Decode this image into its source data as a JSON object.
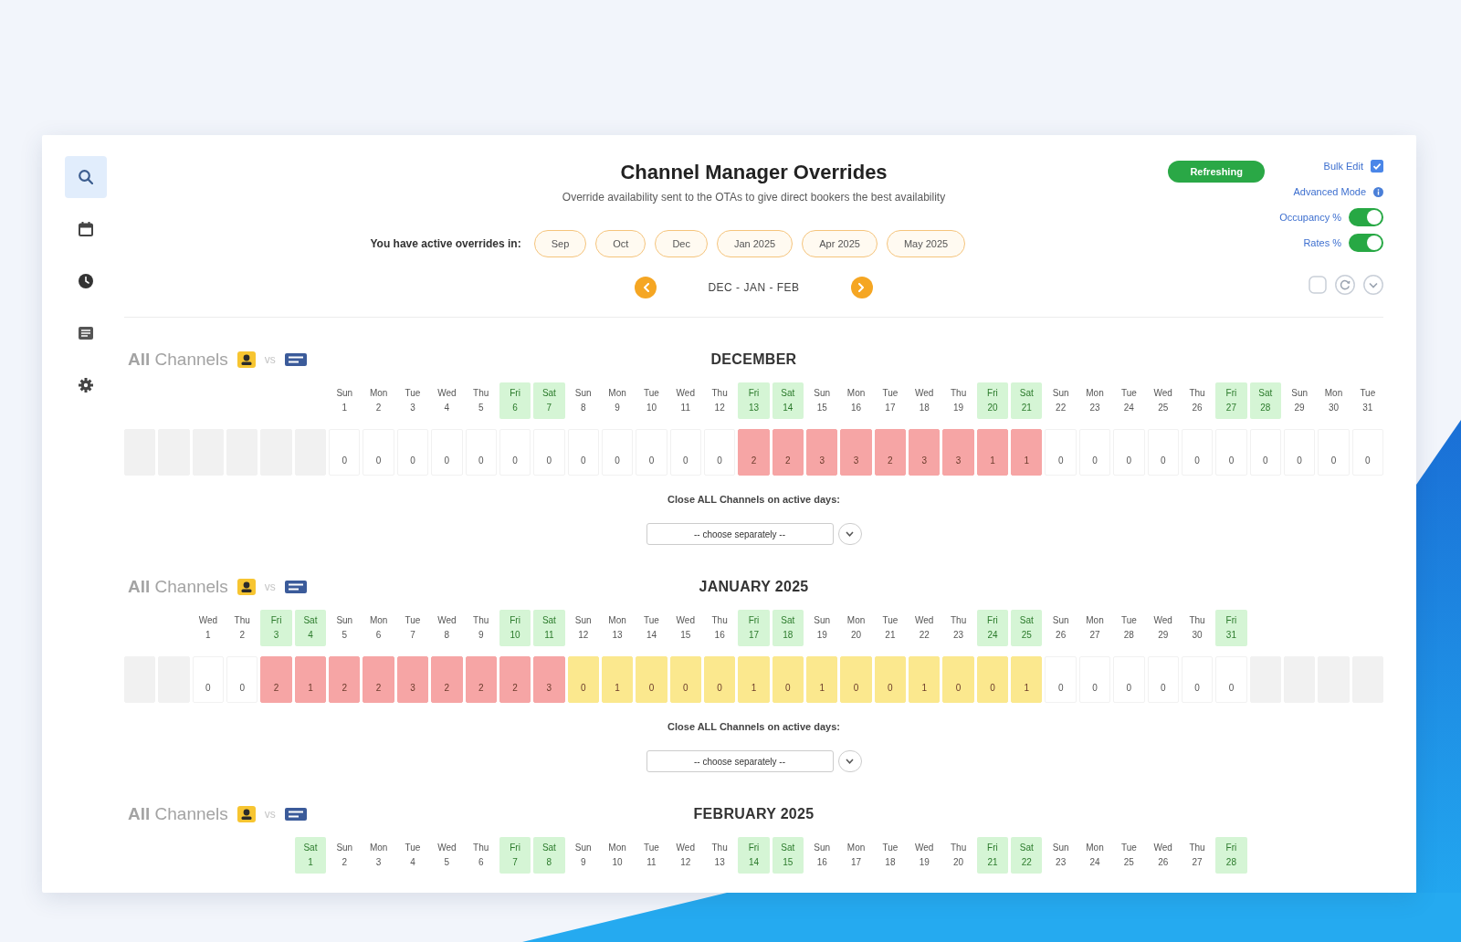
{
  "sidebar": {
    "items": [
      {
        "kind": "search",
        "selected": true
      },
      {
        "kind": "calendar",
        "selected": false
      },
      {
        "kind": "clock",
        "selected": false
      },
      {
        "kind": "list",
        "selected": false
      },
      {
        "kind": "settings",
        "selected": false
      }
    ]
  },
  "header": {
    "title": "Channel Manager Overrides",
    "subtitle": "Override availability sent to the OTAs to give direct bookers the best availability",
    "active_overrides": {
      "label": "You have active overrides in:",
      "months": [
        "Sep",
        "Oct",
        "Dec",
        "Jan 2025",
        "Apr 2025",
        "May 2025"
      ]
    },
    "navigation": {
      "range": "DEC - JAN - FEB"
    }
  },
  "status_button": {
    "label": "Refreshing"
  },
  "options": [
    {
      "kind": "checkbox",
      "label": "Bulk Edit",
      "checked": true
    },
    {
      "kind": "info",
      "label": "Advanced Mode"
    },
    {
      "kind": "toggle",
      "label": "Occupancy %",
      "on": true
    },
    {
      "kind": "toggle",
      "label": "Rates %",
      "on": true
    }
  ],
  "months": [
    {
      "channels_label": "**All** Channels",
      "versus": "vs",
      "title": "DECEMBER",
      "columns": [
        {
          "kind": "blank"
        },
        {
          "kind": "blank"
        },
        {
          "kind": "blank"
        },
        {
          "kind": "blank"
        },
        {
          "kind": "blank"
        },
        {
          "kind": "blank"
        },
        {
          "kind": "day",
          "weekday": "Sun",
          "day": "1",
          "weekend": false,
          "value": "0"
        },
        {
          "kind": "day",
          "weekday": "Mon",
          "day": "2",
          "weekend": false,
          "value": "0"
        },
        {
          "kind": "day",
          "weekday": "Tue",
          "day": "3",
          "weekend": false,
          "value": "0"
        },
        {
          "kind": "day",
          "weekday": "Wed",
          "day": "4",
          "weekend": false,
          "value": "0"
        },
        {
          "kind": "day",
          "weekday": "Thu",
          "day": "5",
          "weekend": false,
          "value": "0"
        },
        {
          "kind": "day",
          "weekday": "Fri",
          "day": "6",
          "weekend": true,
          "value": "0"
        },
        {
          "kind": "day",
          "weekday": "Sat",
          "day": "7",
          "weekend": true,
          "value": "0"
        },
        {
          "kind": "day",
          "weekday": "Sun",
          "day": "8",
          "weekend": false,
          "value": "0"
        },
        {
          "kind": "day",
          "weekday": "Mon",
          "day": "9",
          "weekend": false,
          "value": "0"
        },
        {
          "kind": "day",
          "weekday": "Tue",
          "day": "10",
          "weekend": false,
          "value": "0"
        },
        {
          "kind": "day",
          "weekday": "Wed",
          "day": "11",
          "weekend": false,
          "value": "0"
        },
        {
          "kind": "day",
          "weekday": "Thu",
          "day": "12",
          "weekend": false,
          "value": "0"
        },
        {
          "kind": "day",
          "weekday": "Fri",
          "day": "13",
          "weekend": true,
          "value": "2",
          "color": "#f6a5a5"
        },
        {
          "kind": "day",
          "weekday": "Sat",
          "day": "14",
          "weekend": true,
          "value": "2",
          "color": "#f6a5a5"
        },
        {
          "kind": "day",
          "weekday": "Sun",
          "day": "15",
          "weekend": false,
          "value": "3",
          "color": "#f6a5a5"
        },
        {
          "kind": "day",
          "weekday": "Mon",
          "day": "16",
          "weekend": false,
          "value": "3",
          "color": "#f6a5a5"
        },
        {
          "kind": "day",
          "weekday": "Tue",
          "day": "17",
          "weekend": false,
          "value": "2",
          "color": "#f6a5a5"
        },
        {
          "kind": "day",
          "weekday": "Wed",
          "day": "18",
          "weekend": false,
          "value": "3",
          "color": "#f6a5a5"
        },
        {
          "kind": "day",
          "weekday": "Thu",
          "day": "19",
          "weekend": false,
          "value": "3",
          "color": "#f6a5a5"
        },
        {
          "kind": "day",
          "weekday": "Fri",
          "day": "20",
          "weekend": true,
          "value": "1",
          "color": "#f6a5a5"
        },
        {
          "kind": "day",
          "weekday": "Sat",
          "day": "21",
          "weekend": true,
          "value": "1",
          "color": "#f6a5a5"
        },
        {
          "kind": "day",
          "weekday": "Sun",
          "day": "22",
          "weekend": false,
          "value": "0"
        },
        {
          "kind": "day",
          "weekday": "Mon",
          "day": "23",
          "weekend": false,
          "value": "0"
        },
        {
          "kind": "day",
          "weekday": "Tue",
          "day": "24",
          "weekend": false,
          "value": "0"
        },
        {
          "kind": "day",
          "weekday": "Wed",
          "day": "25",
          "weekend": false,
          "value": "0"
        },
        {
          "kind": "day",
          "weekday": "Thu",
          "day": "26",
          "weekend": false,
          "value": "0"
        },
        {
          "kind": "day",
          "weekday": "Fri",
          "day": "27",
          "weekend": true,
          "value": "0"
        },
        {
          "kind": "day",
          "weekday": "Sat",
          "day": "28",
          "weekend": true,
          "value": "0"
        },
        {
          "kind": "day",
          "weekday": "Sun",
          "day": "29",
          "weekend": false,
          "value": "0"
        },
        {
          "kind": "day",
          "weekday": "Mon",
          "day": "30",
          "weekend": false,
          "value": "0"
        },
        {
          "kind": "day",
          "weekday": "Tue",
          "day": "31",
          "weekend": false,
          "value": "0"
        }
      ],
      "close_all": {
        "label": "Close ALL Channels on active days:",
        "value": "-- choose separately --"
      }
    },
    {
      "channels_label": "**All** Channels",
      "versus": "vs",
      "title": "JANUARY 2025",
      "columns": [
        {
          "kind": "blank"
        },
        {
          "kind": "blank"
        },
        {
          "kind": "day",
          "weekday": "Wed",
          "day": "1",
          "weekend": false,
          "value": "0"
        },
        {
          "kind": "day",
          "weekday": "Thu",
          "day": "2",
          "weekend": false,
          "value": "0"
        },
        {
          "kind": "day",
          "weekday": "Fri",
          "day": "3",
          "weekend": true,
          "value": "2",
          "color": "#f6a5a5"
        },
        {
          "kind": "day",
          "weekday": "Sat",
          "day": "4",
          "weekend": true,
          "value": "1",
          "color": "#f6a5a5"
        },
        {
          "kind": "day",
          "weekday": "Sun",
          "day": "5",
          "weekend": false,
          "value": "2",
          "color": "#f6a5a5"
        },
        {
          "kind": "day",
          "weekday": "Mon",
          "day": "6",
          "weekend": false,
          "value": "2",
          "color": "#f6a5a5"
        },
        {
          "kind": "day",
          "weekday": "Tue",
          "day": "7",
          "weekend": false,
          "value": "3",
          "color": "#f6a5a5"
        },
        {
          "kind": "day",
          "weekday": "Wed",
          "day": "8",
          "weekend": false,
          "value": "2",
          "color": "#f6a5a5"
        },
        {
          "kind": "day",
          "weekday": "Thu",
          "day": "9",
          "weekend": false,
          "value": "2",
          "color": "#f6a5a5"
        },
        {
          "kind": "day",
          "weekday": "Fri",
          "day": "10",
          "weekend": true,
          "value": "2",
          "color": "#f6a5a5"
        },
        {
          "kind": "day",
          "weekday": "Sat",
          "day": "11",
          "weekend": true,
          "value": "3",
          "color": "#f6a5a5"
        },
        {
          "kind": "day",
          "weekday": "Sun",
          "day": "12",
          "weekend": false,
          "value": "0",
          "color": "#fbe88e"
        },
        {
          "kind": "day",
          "weekday": "Mon",
          "day": "13",
          "weekend": false,
          "value": "1",
          "color": "#fbe88e"
        },
        {
          "kind": "day",
          "weekday": "Tue",
          "day": "14",
          "weekend": false,
          "value": "0",
          "color": "#fbe88e"
        },
        {
          "kind": "day",
          "weekday": "Wed",
          "day": "15",
          "weekend": false,
          "value": "0",
          "color": "#fbe88e"
        },
        {
          "kind": "day",
          "weekday": "Thu",
          "day": "16",
          "weekend": false,
          "value": "0",
          "color": "#fbe88e"
        },
        {
          "kind": "day",
          "weekday": "Fri",
          "day": "17",
          "weekend": true,
          "value": "1",
          "color": "#fbe88e"
        },
        {
          "kind": "day",
          "weekday": "Sat",
          "day": "18",
          "weekend": true,
          "value": "0",
          "color": "#fbe88e"
        },
        {
          "kind": "day",
          "weekday": "Sun",
          "day": "19",
          "weekend": false,
          "value": "1",
          "color": "#fbe88e"
        },
        {
          "kind": "day",
          "weekday": "Mon",
          "day": "20",
          "weekend": false,
          "value": "0",
          "color": "#fbe88e"
        },
        {
          "kind": "day",
          "weekday": "Tue",
          "day": "21",
          "weekend": false,
          "value": "0",
          "color": "#fbe88e"
        },
        {
          "kind": "day",
          "weekday": "Wed",
          "day": "22",
          "weekend": false,
          "value": "1",
          "color": "#fbe88e"
        },
        {
          "kind": "day",
          "weekday": "Thu",
          "day": "23",
          "weekend": false,
          "value": "0",
          "color": "#fbe88e"
        },
        {
          "kind": "day",
          "weekday": "Fri",
          "day": "24",
          "weekend": true,
          "value": "0",
          "color": "#fbe88e"
        },
        {
          "kind": "day",
          "weekday": "Sat",
          "day": "25",
          "weekend": true,
          "value": "1",
          "color": "#fbe88e"
        },
        {
          "kind": "day",
          "weekday": "Sun",
          "day": "26",
          "weekend": false,
          "value": "0"
        },
        {
          "kind": "day",
          "weekday": "Mon",
          "day": "27",
          "weekend": false,
          "value": "0"
        },
        {
          "kind": "day",
          "weekday": "Tue",
          "day": "28",
          "weekend": false,
          "value": "0"
        },
        {
          "kind": "day",
          "weekday": "Wed",
          "day": "29",
          "weekend": false,
          "value": "0"
        },
        {
          "kind": "day",
          "weekday": "Thu",
          "day": "30",
          "weekend": false,
          "value": "0"
        },
        {
          "kind": "day",
          "weekday": "Fri",
          "day": "31",
          "weekend": true,
          "value": "0"
        },
        {
          "kind": "blank"
        },
        {
          "kind": "blank"
        },
        {
          "kind": "blank"
        },
        {
          "kind": "blank"
        }
      ],
      "close_all": {
        "label": "Close ALL Channels on active days:",
        "value": "-- choose separately --"
      }
    },
    {
      "channels_label": "**All** Channels",
      "versus": "vs",
      "title": "FEBRUARY 2025",
      "columns": [
        {
          "kind": "blank"
        },
        {
          "kind": "blank"
        },
        {
          "kind": "blank"
        },
        {
          "kind": "blank"
        },
        {
          "kind": "blank"
        },
        {
          "kind": "day",
          "weekday": "Sat",
          "day": "1",
          "weekend": true
        },
        {
          "kind": "day",
          "weekday": "Sun",
          "day": "2",
          "weekend": false
        },
        {
          "kind": "day",
          "weekday": "Mon",
          "day": "3",
          "weekend": false
        },
        {
          "kind": "day",
          "weekday": "Tue",
          "day": "4",
          "weekend": false
        },
        {
          "kind": "day",
          "weekday": "Wed",
          "day": "5",
          "weekend": false
        },
        {
          "kind": "day",
          "weekday": "Thu",
          "day": "6",
          "weekend": false
        },
        {
          "kind": "day",
          "weekday": "Fri",
          "day": "7",
          "weekend": true
        },
        {
          "kind": "day",
          "weekday": "Sat",
          "day": "8",
          "weekend": true
        },
        {
          "kind": "day",
          "weekday": "Sun",
          "day": "9",
          "weekend": false
        },
        {
          "kind": "day",
          "weekday": "Mon",
          "day": "10",
          "weekend": false
        },
        {
          "kind": "day",
          "weekday": "Tue",
          "day": "11",
          "weekend": false
        },
        {
          "kind": "day",
          "weekday": "Wed",
          "day": "12",
          "weekend": false
        },
        {
          "kind": "day",
          "weekday": "Thu",
          "day": "13",
          "weekend": false
        },
        {
          "kind": "day",
          "weekday": "Fri",
          "day": "14",
          "weekend": true
        },
        {
          "kind": "day",
          "weekday": "Sat",
          "day": "15",
          "weekend": true
        },
        {
          "kind": "day",
          "weekday": "Sun",
          "day": "16",
          "weekend": false
        },
        {
          "kind": "day",
          "weekday": "Mon",
          "day": "17",
          "weekend": false
        },
        {
          "kind": "day",
          "weekday": "Tue",
          "day": "18",
          "weekend": false
        },
        {
          "kind": "day",
          "weekday": "Wed",
          "day": "19",
          "weekend": false
        },
        {
          "kind": "day",
          "weekday": "Thu",
          "day": "20",
          "weekend": false
        },
        {
          "kind": "day",
          "weekday": "Fri",
          "day": "21",
          "weekend": true
        },
        {
          "kind": "day",
          "weekday": "Sat",
          "day": "22",
          "weekend": true
        },
        {
          "kind": "day",
          "weekday": "Sun",
          "day": "23",
          "weekend": false
        },
        {
          "kind": "day",
          "weekday": "Mon",
          "day": "24",
          "weekend": false
        },
        {
          "kind": "day",
          "weekday": "Tue",
          "day": "25",
          "weekend": false
        },
        {
          "kind": "day",
          "weekday": "Wed",
          "day": "26",
          "weekend": false
        },
        {
          "kind": "day",
          "weekday": "Thu",
          "day": "27",
          "weekend": false
        },
        {
          "kind": "day",
          "weekday": "Fri",
          "day": "28",
          "weekend": true
        },
        {
          "kind": "blank"
        },
        {
          "kind": "blank"
        },
        {
          "kind": "blank"
        },
        {
          "kind": "blank"
        }
      ]
    }
  ]
}
